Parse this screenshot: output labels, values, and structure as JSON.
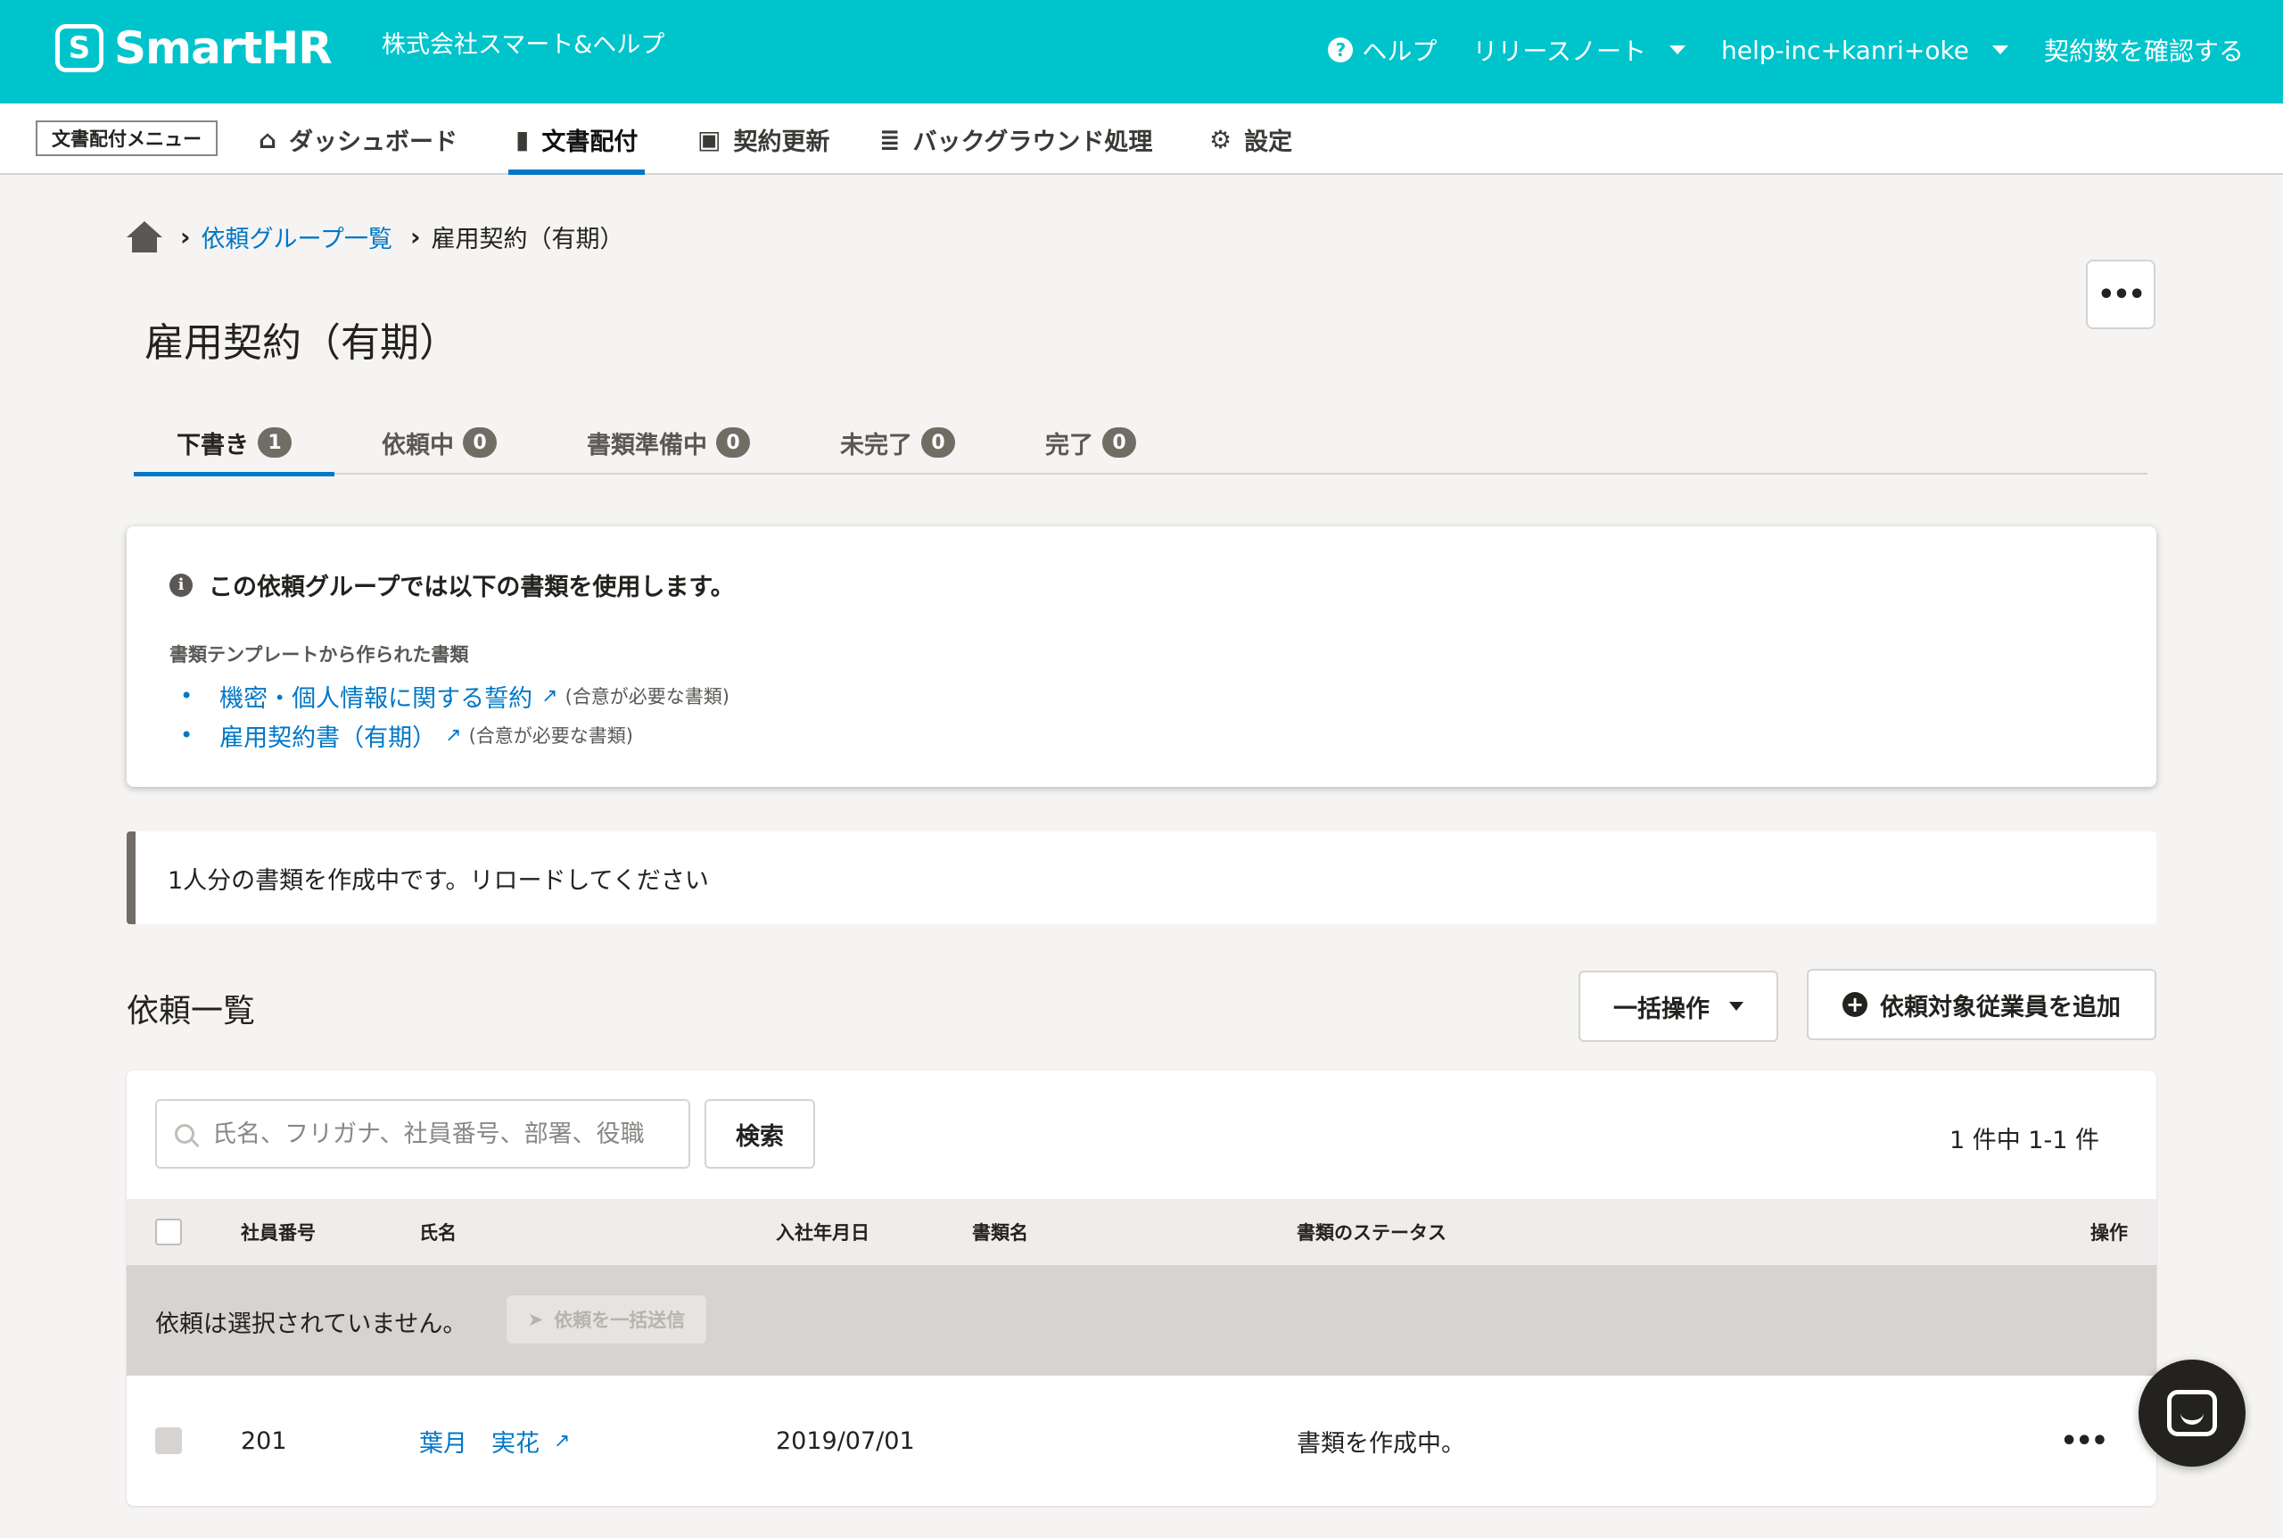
{
  "header": {
    "logo_mark": "S",
    "logo_text": "SmartHR",
    "company": "株式会社スマート&ヘルプ",
    "help_label": "ヘルプ",
    "release_notes_label": "リリースノート",
    "account_label": "help-inc+kanri+oke",
    "contract_label": "契約数を確認する",
    "accent_color": "#00c4cc"
  },
  "subnav": {
    "menu_label": "文書配付メニュー",
    "tabs": [
      {
        "label": "ダッシュボード",
        "icon": "home-icon"
      },
      {
        "label": "文書配付",
        "icon": "file-icon",
        "active": true
      },
      {
        "label": "契約更新",
        "icon": "calendar-check-icon"
      },
      {
        "label": "バックグラウンド処理",
        "icon": "database-icon"
      },
      {
        "label": "設定",
        "icon": "gear-icon"
      }
    ]
  },
  "breadcrumb": {
    "parent": "依頼グループ一覧",
    "current": "雇用契約（有期）"
  },
  "page": {
    "title": "雇用契約（有期）",
    "more_label": "•••"
  },
  "tabs": [
    {
      "label": "下書き",
      "count": "1",
      "active": true
    },
    {
      "label": "依頼中",
      "count": "0"
    },
    {
      "label": "書類準備中",
      "count": "0"
    },
    {
      "label": "未完了",
      "count": "0"
    },
    {
      "label": "完了",
      "count": "0"
    }
  ],
  "info": {
    "title": "この依頼グループでは以下の書類を使用します。",
    "subtitle": "書類テンプレートから作られた書類",
    "documents": [
      {
        "name": "機密・個人情報に関する誓約",
        "note": "(合意が必要な書類)"
      },
      {
        "name": "雇用契約書（有期）",
        "note": "(合意が必要な書類)"
      }
    ]
  },
  "notice": {
    "text": "1人分の書類を作成中です。リロードしてください"
  },
  "list": {
    "heading": "依頼一覧",
    "bulk_label": "一括操作",
    "add_label": "依頼対象従業員を追加",
    "search_placeholder": "氏名、フリガナ、社員番号、部署、役職",
    "search_button": "検索",
    "count_text": "1 件中 1-1 件",
    "columns": {
      "employee_no": "社員番号",
      "name": "氏名",
      "join_date": "入社年月日",
      "doc_name": "書類名",
      "status": "書類のステータス",
      "actions": "操作"
    },
    "selection_text": "依頼は選択されていません。",
    "send_all_label": "依頼を一括送信",
    "rows": [
      {
        "employee_no": "201",
        "name": "葉月　実花",
        "join_date": "2019/07/01",
        "doc_name": "",
        "status": "書類を作成中。",
        "more": "•••"
      }
    ]
  }
}
